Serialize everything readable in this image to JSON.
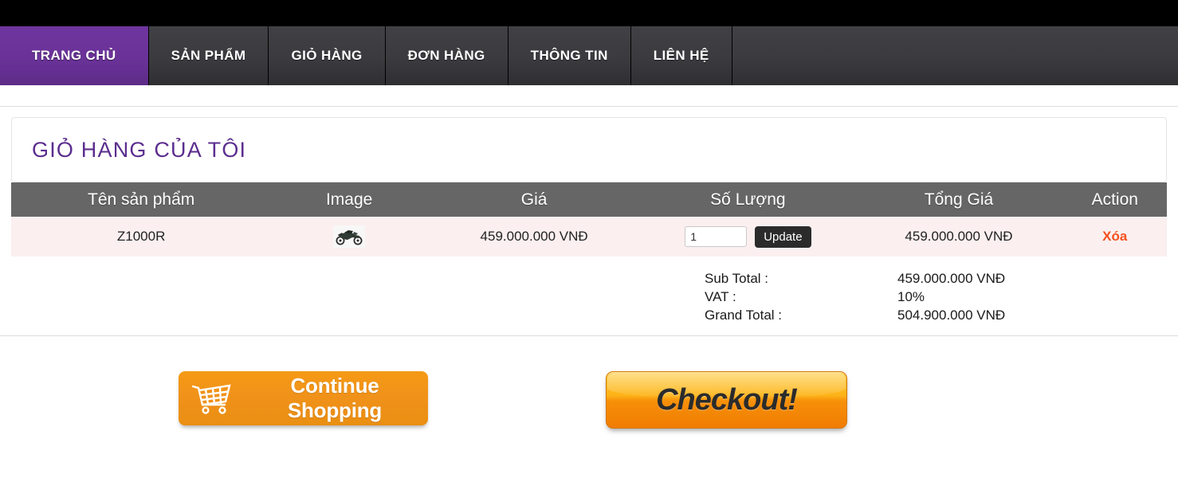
{
  "nav": {
    "items": [
      {
        "label": "TRANG CHỦ",
        "active": true
      },
      {
        "label": "SẢN PHẨM",
        "active": false
      },
      {
        "label": "GIỎ HÀNG",
        "active": false
      },
      {
        "label": "ĐƠN HÀNG",
        "active": false
      },
      {
        "label": "THÔNG TIN",
        "active": false
      },
      {
        "label": "LIÊN HỆ",
        "active": false
      }
    ],
    "active_color": "#6a3298",
    "inactive_color": "#3b3b3f"
  },
  "page": {
    "title": "GIỎ HÀNG CỦA TÔI",
    "title_color": "#5b2d8e"
  },
  "table": {
    "headers": {
      "name": "Tên sản phẩm",
      "image": "Image",
      "price": "Giá",
      "quantity": "Số Lượng",
      "total": "Tổng Giá",
      "action": "Action"
    },
    "header_bg": "#666666",
    "row_bg": "#fbeff0",
    "rows": [
      {
        "name": "Z1000R",
        "image_icon": "motorcycle-thumbnail",
        "price": "459.000.000 VNĐ",
        "quantity": "1",
        "update_label": "Update",
        "total": "459.000.000 VNĐ",
        "action_label": "Xóa",
        "action_color": "#f4511e"
      }
    ]
  },
  "totals": {
    "sub_total_label": "Sub Total :",
    "sub_total_value": "459.000.000 VNĐ",
    "vat_label": "VAT :",
    "vat_value": "10%",
    "grand_total_label": "Grand Total :",
    "grand_total_value": "504.900.000 VNĐ"
  },
  "buttons": {
    "continue_label": "Continue Shopping",
    "continue_color": "#f0911a",
    "checkout_label": "Checkout!",
    "checkout_color": "#f79009"
  }
}
